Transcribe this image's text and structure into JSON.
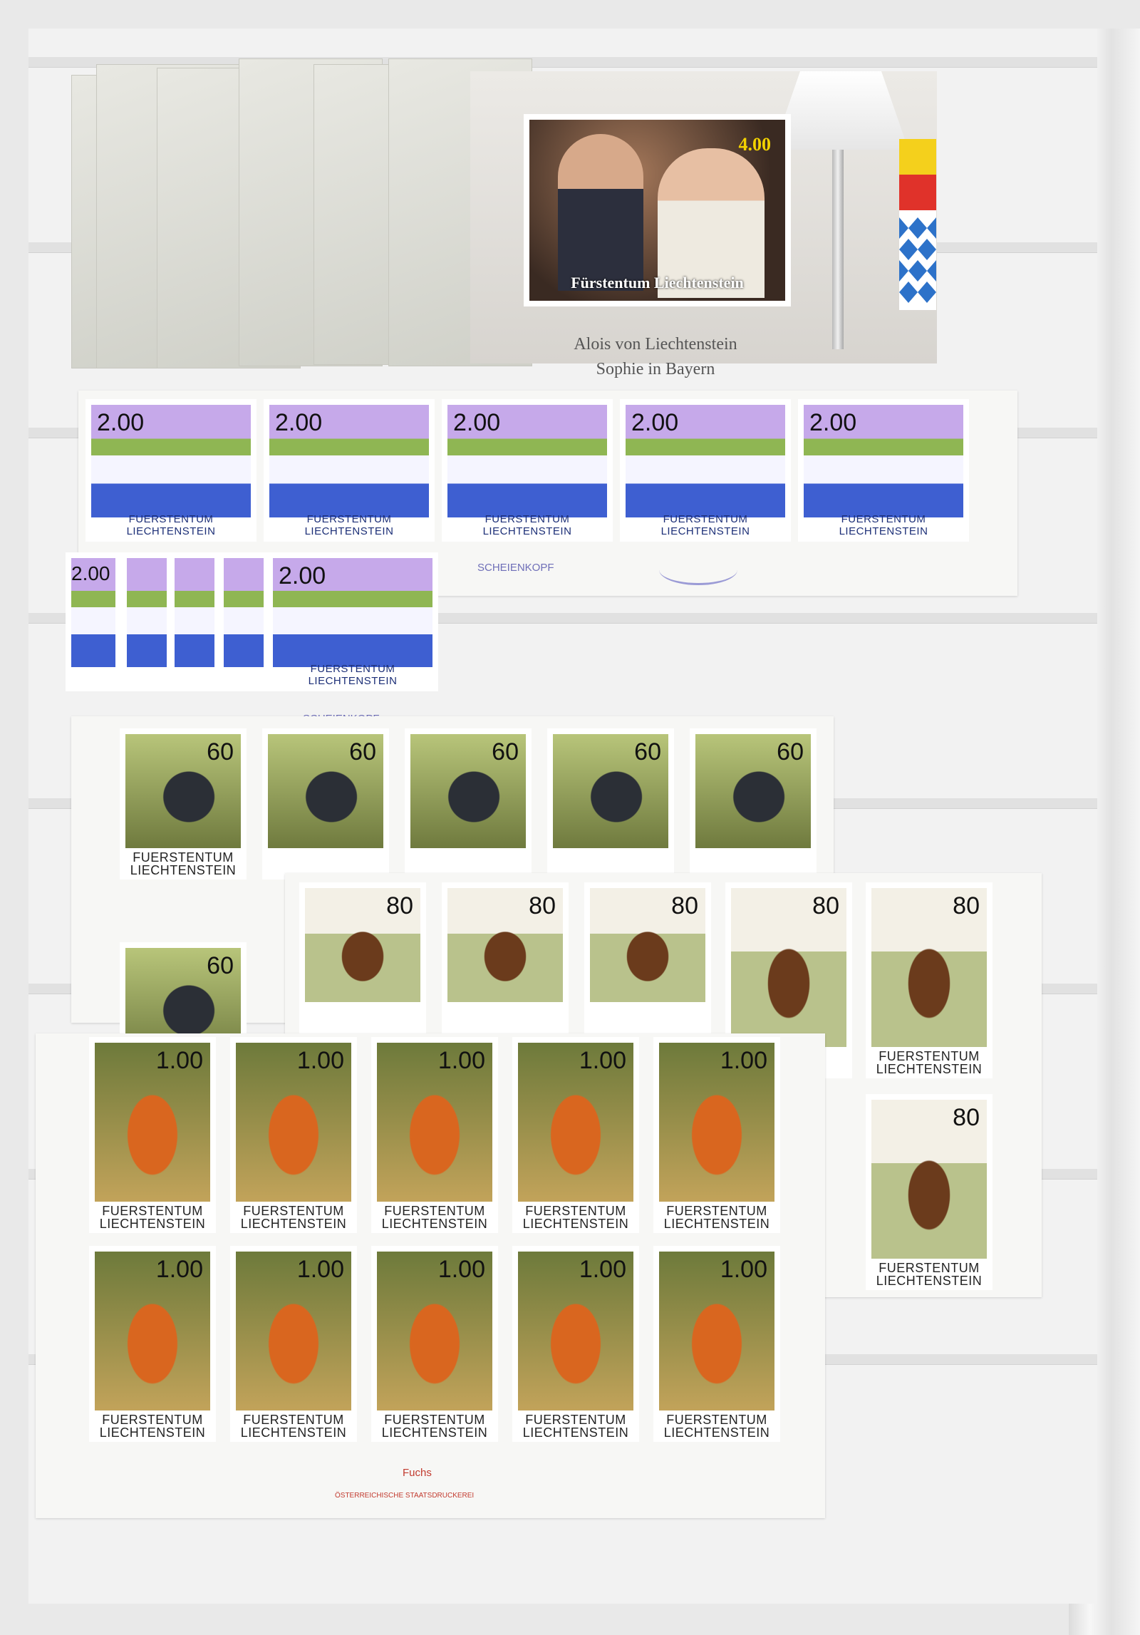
{
  "souvenir_sheet": {
    "stamp_title": "Fürstentum Liechtenstein",
    "stamp_value": "4.00",
    "caption_line1": "Alois von Liechtenstein",
    "caption_line2": "Sophie in Bayern"
  },
  "mountain_block": {
    "value": "2.00",
    "country": "FUERSTENTUM LIECHTENSTEIN",
    "margin_label": "SCHEIENKOPF",
    "margin_label_2": "SCHEIENKOPF"
  },
  "badger_block": {
    "value": "60",
    "country_line1": "FUERSTENTUM",
    "country_line2": "LIECHTENSTEIN"
  },
  "marten_block": {
    "value": "80",
    "country_line1": "FUERSTENTUM",
    "country_line2": "LIECHTENSTEIN"
  },
  "fox_block": {
    "value": "1.00",
    "country_line1": "FUERSTENTUM",
    "country_line2": "LIECHTENSTEIN",
    "margin_label": "Fuchs",
    "printer": "ÖSTERREICHISCHE STAATSDRUCKEREI"
  }
}
